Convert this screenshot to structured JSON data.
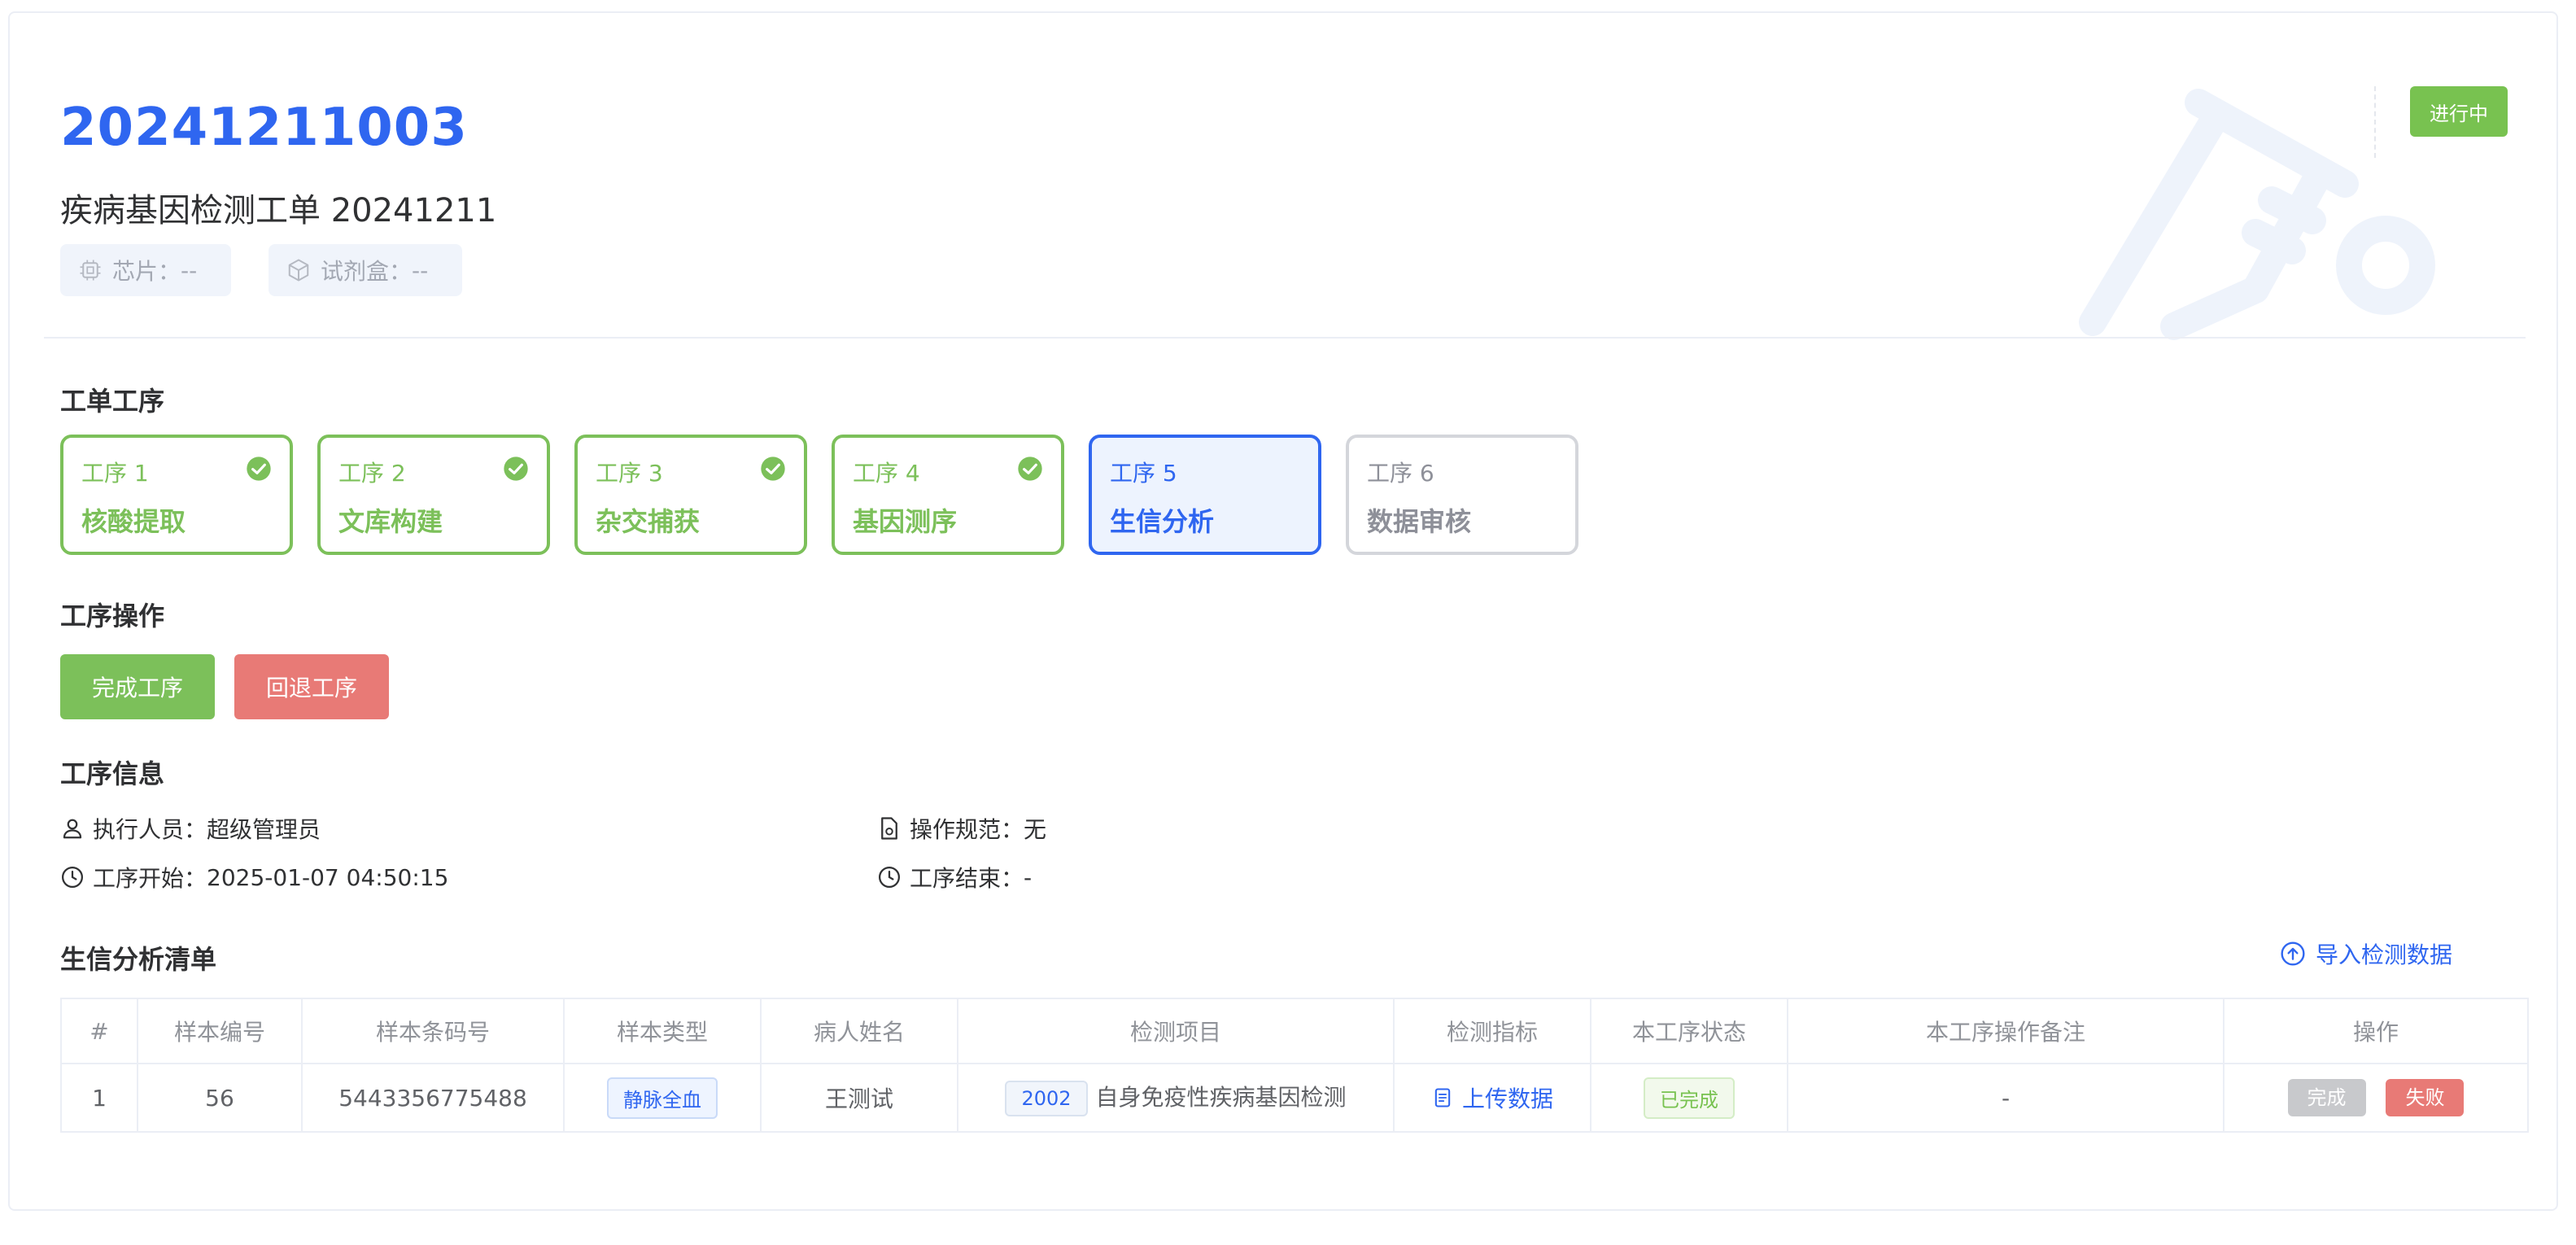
{
  "header": {
    "order_no": "20241211003",
    "title": "疾病基因检测工单 20241211",
    "chip": {
      "label": "芯片：",
      "value": "--",
      "icon": "chip-icon"
    },
    "kit": {
      "label": "试剂盒：",
      "value": "--",
      "icon": "box-icon"
    },
    "status": "进行中",
    "status_color": "#78c250"
  },
  "steps_section": {
    "title": "工单工序",
    "steps": [
      {
        "num": "工序 1",
        "name": "核酸提取",
        "state": "done"
      },
      {
        "num": "工序 2",
        "name": "文库构建",
        "state": "done"
      },
      {
        "num": "工序 3",
        "name": "杂交捕获",
        "state": "done"
      },
      {
        "num": "工序 4",
        "name": "基因测序",
        "state": "done"
      },
      {
        "num": "工序 5",
        "name": "生信分析",
        "state": "active"
      },
      {
        "num": "工序 6",
        "name": "数据审核",
        "state": "pending"
      }
    ]
  },
  "ops_section": {
    "title": "工序操作",
    "complete_label": "完成工序",
    "rollback_label": "回退工序",
    "complete_color": "#7cc05a",
    "rollback_color": "#e87a76"
  },
  "info_section": {
    "title": "工序信息",
    "executor_label": "执行人员：",
    "executor": "超级管理员",
    "spec_label": "操作规范：",
    "spec": "无",
    "start_label": "工序开始：",
    "start": "2025-01-07 04:50:15",
    "end_label": "工序结束：",
    "end": "-"
  },
  "list_section": {
    "title": "生信分析清单",
    "import_label": "导入检测数据",
    "columns": [
      "#",
      "样本编号",
      "样本条码号",
      "样本类型",
      "病人姓名",
      "检测项目",
      "检测指标",
      "本工序状态",
      "本工序操作备注",
      "操作"
    ],
    "rows": [
      {
        "index": "1",
        "sample_no": "56",
        "barcode": "5443356775488",
        "sample_type": "静脉全血",
        "patient": "王测试",
        "project_code": "2002",
        "project_name": "自身免疫性疾病基因检测",
        "indicator": "上传数据",
        "status": "已完成",
        "remark": "-",
        "action_done": "完成",
        "action_fail": "失败"
      }
    ]
  },
  "colors": {
    "primary": "#2f66f0",
    "success": "#78c250",
    "danger": "#e87a76",
    "disabled": "#c8c9cc"
  }
}
